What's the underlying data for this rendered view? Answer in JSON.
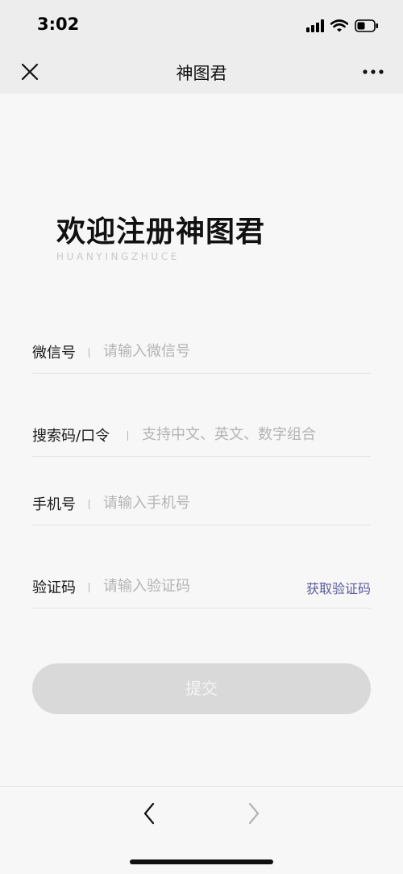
{
  "status_bar": {
    "time": "3:02",
    "icons": [
      "signal-icon",
      "wifi-icon",
      "battery-icon"
    ]
  },
  "nav": {
    "title": "神图君",
    "close_icon": "close-icon",
    "more_icon": "more-icon"
  },
  "welcome": {
    "title": "欢迎注册神图君",
    "subtitle": "HUANYINGZHUCE"
  },
  "form": {
    "wechat": {
      "label": "微信号",
      "placeholder": "请输入微信号",
      "value": ""
    },
    "code": {
      "label": "搜索码/口令",
      "placeholder": "支持中文、英文、数字组合",
      "value": ""
    },
    "phone": {
      "label": "手机号",
      "placeholder": "请输入手机号",
      "value": ""
    },
    "verify": {
      "label": "验证码",
      "placeholder": "请输入验证码",
      "value": "",
      "action": "获取验证码"
    },
    "submit": "提交"
  },
  "colors": {
    "background": "#f7f7f7",
    "header": "#ededed",
    "link": "#5a5a9c",
    "button_disabled": "#d9d9d9"
  },
  "bottom_nav": {
    "back_icon": "chevron-left-icon",
    "forward_icon": "chevron-right-icon"
  }
}
